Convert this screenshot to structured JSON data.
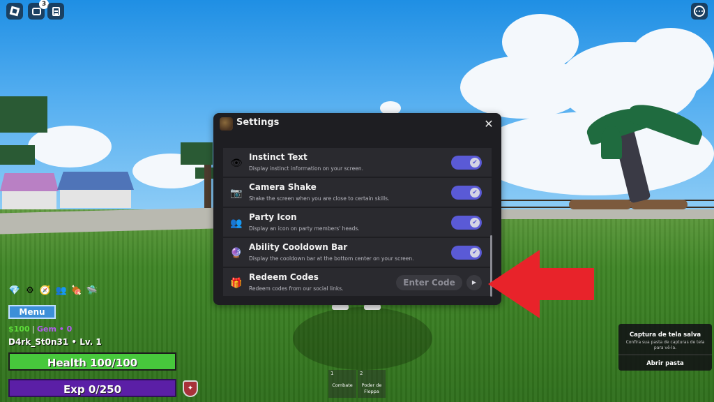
{
  "top_bar": {
    "roblox_menu_icon": "roblox-logo-icon",
    "chat_icon": "chat-icon",
    "chat_badge": "3",
    "notes_icon": "clipboard-icon",
    "more_icon": "more-options-icon"
  },
  "settings": {
    "title": "Settings",
    "close_glyph": "✕",
    "rows": [
      {
        "icon": "eye-icon",
        "glyph": "👁",
        "title": "Instinct Text",
        "description": "Display instinct information on your screen.",
        "enabled": true
      },
      {
        "icon": "camera-icon",
        "glyph": "📷",
        "title": "Camera Shake",
        "description": "Shake the screen when you are close to certain skills.",
        "enabled": true
      },
      {
        "icon": "party-icon",
        "glyph": "👥",
        "title": "Party Icon",
        "description": "Display an icon on party members' heads.",
        "enabled": true
      },
      {
        "icon": "ability-icon",
        "glyph": "🔮",
        "title": "Ability Cooldown Bar",
        "description": "Display the cooldown bar at the bottom center on your screen.",
        "enabled": true
      },
      {
        "icon": "gift-icon",
        "glyph": "🎁",
        "title": "Redeem Codes",
        "description": "Redeem codes from our social links.",
        "input_placeholder": "Enter Code",
        "button_glyph": "▶"
      }
    ],
    "toggle_check": "✔"
  },
  "hud": {
    "menu_label": "Menu",
    "money": "$100",
    "money_separator": "|",
    "gem": "Gem • 0",
    "player_name": "D4rk_St0n31 • Lv. 1",
    "health_label": "Health 100/100",
    "health_fraction": 1.0,
    "exp_label": "Exp 0/250",
    "exp_fraction": 0.0,
    "hotbar_icons": [
      "gem-stack-icon",
      "gear-icon",
      "compass-icon",
      "party-icon",
      "meat-icon",
      "ufo-icon"
    ],
    "hotbar_glyphs": [
      "💎",
      "⚙",
      "🧭",
      "👥",
      "🍖",
      "🛸"
    ],
    "shield_glyph": "✦"
  },
  "slots": [
    {
      "number": "1",
      "label": "Combate"
    },
    {
      "number": "2",
      "label": "Poder de Floppa"
    }
  ],
  "toast": {
    "title": "Captura de tela salva",
    "description": "Confira sua pasta de capturas de tela para vê-la.",
    "button": "Abrir pasta"
  },
  "colors": {
    "toggle_on": "#5a5ad6",
    "health": "#47c83c",
    "exp": "#5b1fa6",
    "arrow": "#e8232a",
    "money": "#5ddc3a",
    "gem": "#b45cf0"
  }
}
